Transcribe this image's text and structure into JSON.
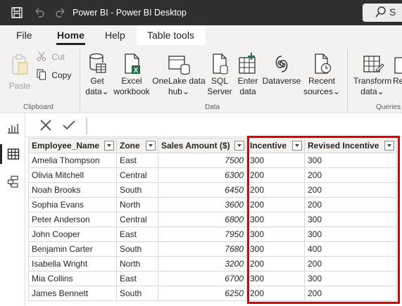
{
  "window": {
    "title": "Power BI - Power BI Desktop",
    "search_label": "S"
  },
  "menu": {
    "tabs": [
      "File",
      "Home",
      "Help",
      "Table tools"
    ],
    "active_tab": "Home"
  },
  "ribbon": {
    "clipboard": {
      "paste": "Paste",
      "cut": "Cut",
      "copy": "Copy",
      "group_label": "Clipboard"
    },
    "data": {
      "get_data": [
        "Get",
        "data"
      ],
      "excel_workbook": [
        "Excel",
        "workbook"
      ],
      "onelake_data_hub": [
        "OneLake data",
        "hub"
      ],
      "sql_server": [
        "SQL",
        "Server"
      ],
      "enter_data": [
        "Enter",
        "data"
      ],
      "dataverse": "Dataverse",
      "recent_sources": [
        "Recent",
        "sources"
      ],
      "group_label": "Data"
    },
    "queries": {
      "transform_data": [
        "Transform",
        "data"
      ],
      "refresh_partial": "Re",
      "group_label": "Queries"
    }
  },
  "table": {
    "columns": [
      "Employee_Name",
      "Zone",
      "Sales Amount ($)",
      "Incentive",
      "Revised Incentive"
    ],
    "rows": [
      [
        "Amelia Thompson",
        "East",
        "7500",
        "300",
        "300"
      ],
      [
        "Olivia Mitchell",
        "Central",
        "6300",
        "200",
        "200"
      ],
      [
        "Noah Brooks",
        "South",
        "6450",
        "200",
        "200"
      ],
      [
        "Sophia Evans",
        "North",
        "3600",
        "200",
        "200"
      ],
      [
        "Peter Anderson",
        "Central",
        "6800",
        "300",
        "300"
      ],
      [
        "John Cooper",
        "East",
        "7950",
        "300",
        "300"
      ],
      [
        "Benjamin Carter",
        "South",
        "7680",
        "300",
        "400"
      ],
      [
        "Isabella Wright",
        "North",
        "3200",
        "200",
        "200"
      ],
      [
        "Mia Collins",
        "East",
        "6700",
        "300",
        "300"
      ],
      [
        "James Bennett",
        "South",
        "6250",
        "200",
        "200"
      ]
    ]
  },
  "colors": {
    "titlebar": "#2f2f2f",
    "ribbon": "#f3f2f1",
    "highlight": "#e00000",
    "excel_green": "#1d6f42"
  }
}
